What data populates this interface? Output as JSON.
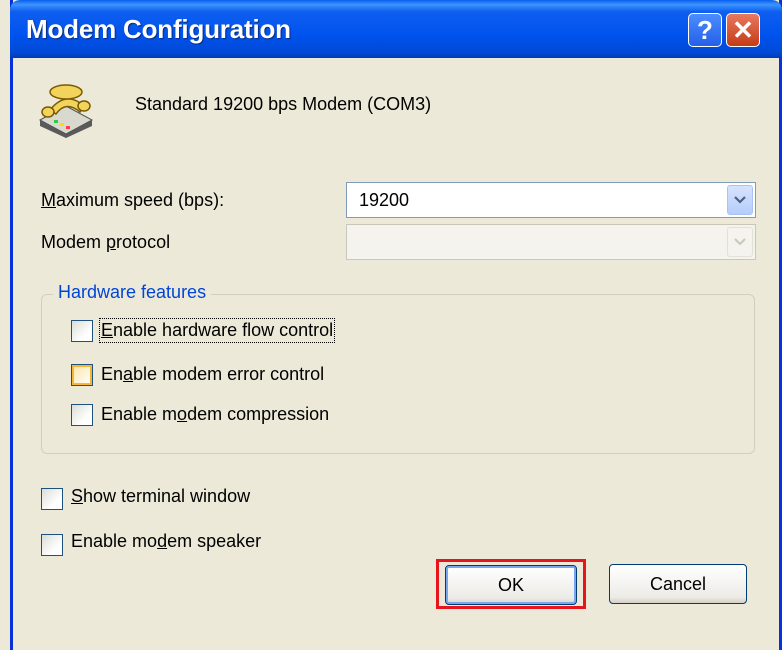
{
  "window": {
    "title": "Modem Configuration",
    "help_label": "?",
    "close_label": "✕"
  },
  "modem": {
    "icon": "telephone-modem-icon",
    "name": "Standard 19200 bps Modem (COM3)"
  },
  "speed": {
    "label_accel": "M",
    "label_rest": "aximum speed (bps):",
    "value": "19200"
  },
  "protocol": {
    "label_pre": "Modem ",
    "label_accel": "p",
    "label_rest": "rotocol",
    "value": ""
  },
  "hardware": {
    "title": "Hardware features",
    "flow_control": {
      "pre": "",
      "accel": "E",
      "rest": "nable hardware flow control",
      "checked": false
    },
    "error_control": {
      "pre": "En",
      "accel": "a",
      "rest": "ble modem error control",
      "checked": false
    },
    "compression": {
      "pre": "Enable m",
      "accel": "o",
      "rest": "dem compression",
      "checked": false
    }
  },
  "terminal": {
    "pre": "",
    "accel": "S",
    "rest": "how terminal window",
    "checked": false
  },
  "speaker": {
    "pre": "Enable mo",
    "accel": "d",
    "rest": "em speaker",
    "checked": false
  },
  "buttons": {
    "ok": "OK",
    "cancel": "Cancel"
  },
  "colors": {
    "title_bar": "#0054E3",
    "highlight_border": "#E8141B",
    "group_title": "#0046D5"
  }
}
